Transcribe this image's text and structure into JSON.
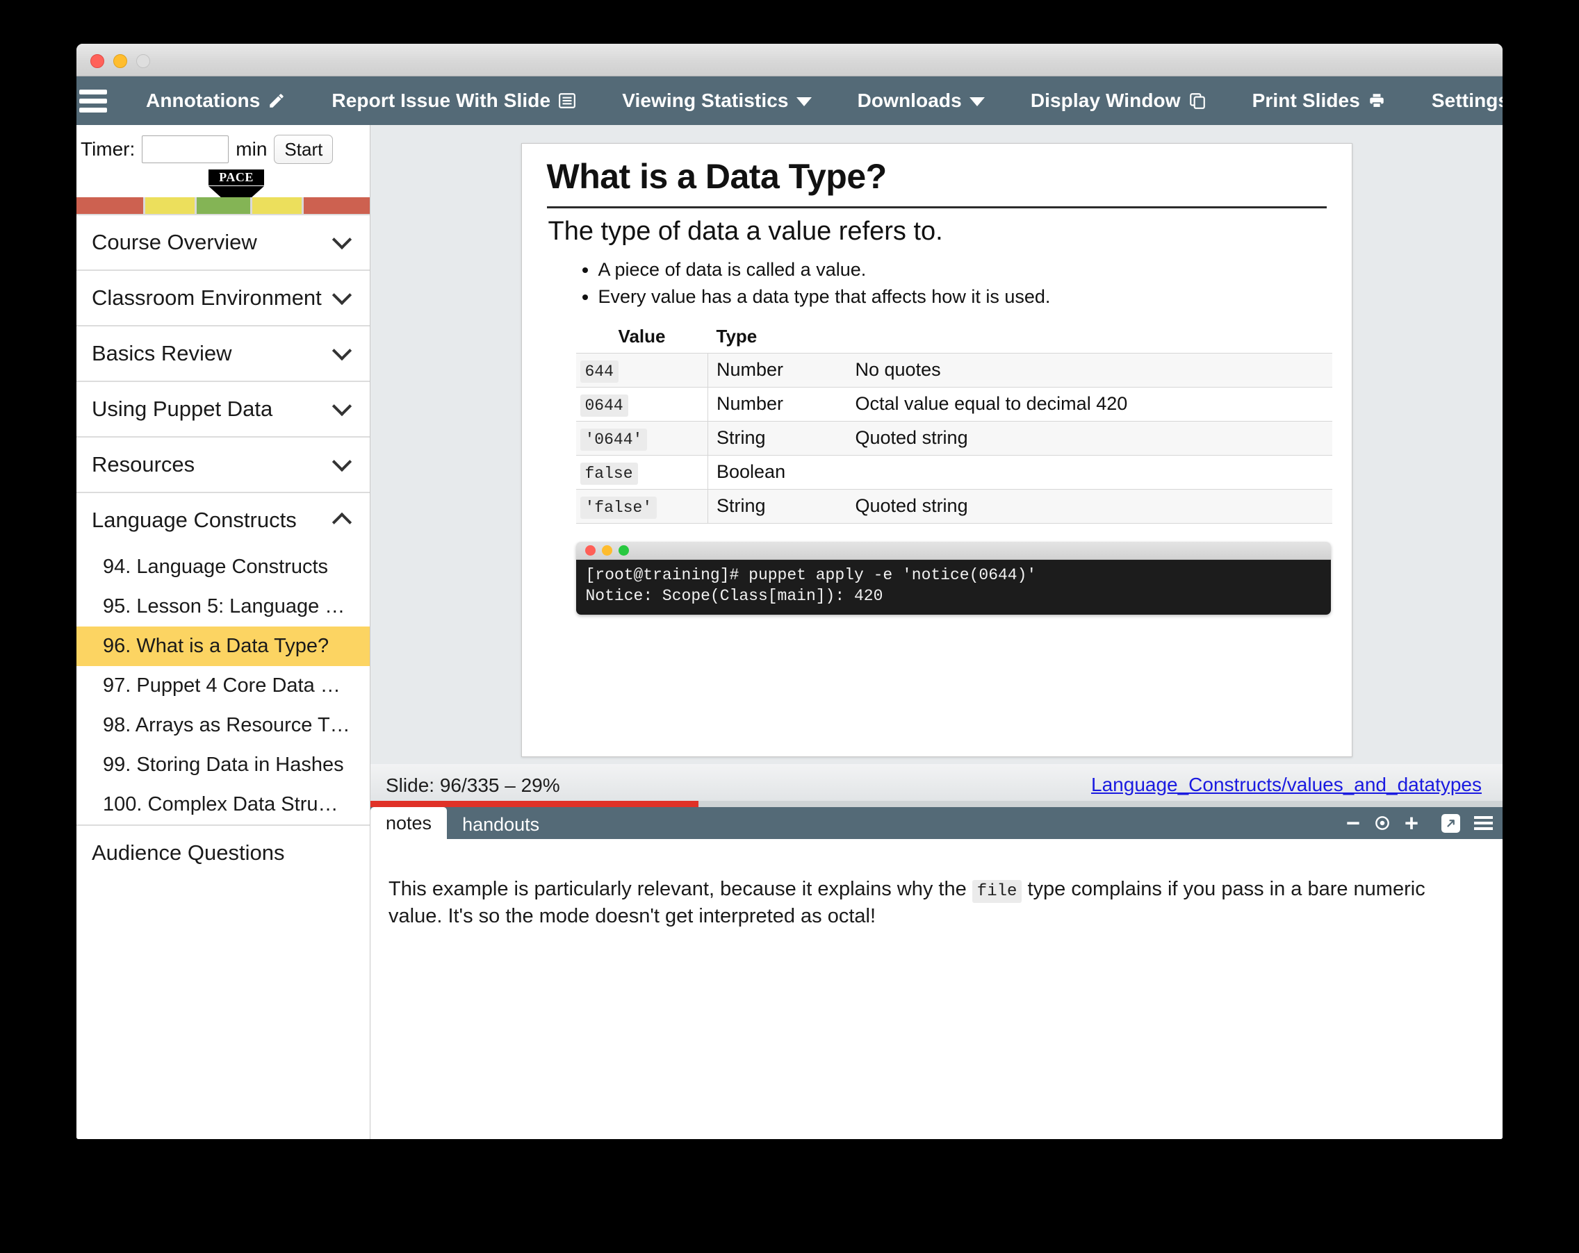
{
  "window": {
    "traffic_lights": [
      "close",
      "minimize",
      "zoom"
    ]
  },
  "toolbar": {
    "menu_icon": "hamburger-icon",
    "items": [
      {
        "label": "Annotations",
        "icon": "pencil-icon"
      },
      {
        "label": "Report Issue With Slide",
        "icon": "list-icon"
      },
      {
        "label": "Viewing Statistics",
        "icon": "chevron-down-icon"
      },
      {
        "label": "Downloads",
        "icon": "chevron-down-icon"
      },
      {
        "label": "Display Window",
        "icon": "copy-icon"
      },
      {
        "label": "Print Slides",
        "icon": "printer-icon"
      },
      {
        "label": "Settings",
        "icon": "gear-icon"
      }
    ]
  },
  "sidebar": {
    "timer": {
      "label": "Timer:",
      "value": "",
      "placeholder": "",
      "unit": "min",
      "start_label": "Start"
    },
    "pace": {
      "marker_label": "PACE",
      "segments": [
        {
          "color": "#cd6150",
          "flex": 200
        },
        {
          "color": "#ecdf5c",
          "flex": 148
        },
        {
          "color": "#84b455",
          "flex": 160
        },
        {
          "color": "#ecdf5c",
          "flex": 148
        },
        {
          "color": "#cd6150",
          "flex": 200
        }
      ]
    },
    "sections": [
      {
        "title": "Course Overview",
        "expanded": false
      },
      {
        "title": "Classroom Environment",
        "expanded": false
      },
      {
        "title": "Basics Review",
        "expanded": false
      },
      {
        "title": "Using Puppet Data",
        "expanded": false
      },
      {
        "title": "Resources",
        "expanded": false
      },
      {
        "title": "Language Constructs",
        "expanded": true
      }
    ],
    "slides": [
      {
        "label": "94. Language Constructs",
        "active": false
      },
      {
        "label": "95. Lesson 5: Language …",
        "active": false
      },
      {
        "label": "96. What is a Data Type?",
        "active": true
      },
      {
        "label": "97. Puppet 4 Core Data …",
        "active": false
      },
      {
        "label": "98. Arrays as Resource T…",
        "active": false
      },
      {
        "label": "99. Storing Data in Hashes",
        "active": false
      },
      {
        "label": "100. Complex Data Stru…",
        "active": false
      }
    ],
    "footer_section": {
      "title": "Audience Questions"
    },
    "active_highlight_color": "#fcd462"
  },
  "slide": {
    "title": "What is a Data Type?",
    "subtitle": "The type of data a value refers to.",
    "bullets": [
      "A piece of data is called a value.",
      "Every value has a data type that affects how it is used."
    ],
    "table": {
      "headers": [
        "Value",
        "Type",
        ""
      ],
      "rows": [
        {
          "value": "644",
          "type": "Number",
          "note": "No quotes"
        },
        {
          "value": "0644",
          "type": "Number",
          "note": "Octal value equal to decimal 420"
        },
        {
          "value": "'0644'",
          "type": "String",
          "note": "Quoted string"
        },
        {
          "value": "false",
          "type": "Boolean",
          "note": ""
        },
        {
          "value": "'false'",
          "type": "String",
          "note": "Quoted string"
        }
      ]
    },
    "terminal": {
      "lights": [
        "#ff5f57",
        "#febc2e",
        "#28c840"
      ],
      "line1": "[root@training]# puppet apply -e 'notice(0644)'",
      "line2": "Notice: Scope(Class[main]): 420"
    }
  },
  "status": {
    "counter": "Slide: 96/335 – 29%",
    "link": "Language_Constructs/values_and_datatypes",
    "progress_percent": 29,
    "progress_color": "#e03127"
  },
  "notes": {
    "tabs": [
      {
        "label": "notes",
        "active": true
      },
      {
        "label": "handouts",
        "active": false
      }
    ],
    "tools": [
      {
        "icon": "minus-icon"
      },
      {
        "icon": "target-icon"
      },
      {
        "icon": "plus-icon"
      },
      {
        "icon": "popout-arrow-icon"
      },
      {
        "icon": "hamburger-icon"
      }
    ],
    "text_before_code": "This example is particularly relevant, because it explains why the ",
    "inline_code": "file",
    "text_after_code": " type complains if you pass in a bare numeric value. It's so the mode doesn't get interpreted as octal!"
  }
}
